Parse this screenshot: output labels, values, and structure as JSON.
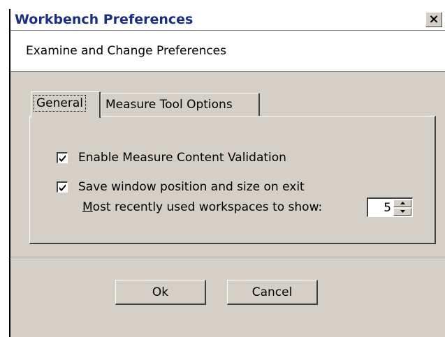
{
  "window": {
    "title": "Workbench Preferences",
    "close_label": "×",
    "subtitle": "Examine and Change Preferences"
  },
  "tabs": [
    {
      "label": "General",
      "selected": true
    },
    {
      "label": "Measure Tool Options",
      "selected": false
    }
  ],
  "general": {
    "validation_label": "Enable Measure Content Validation",
    "validation_checked": true,
    "save_position_label": "Save window position and size on exit",
    "save_position_checked": true,
    "recent_label_mnemonic": "M",
    "recent_label_rest": "ost recently used workspaces to show:",
    "recent_value": "5"
  },
  "buttons": {
    "ok": "Ok",
    "cancel": "Cancel"
  }
}
